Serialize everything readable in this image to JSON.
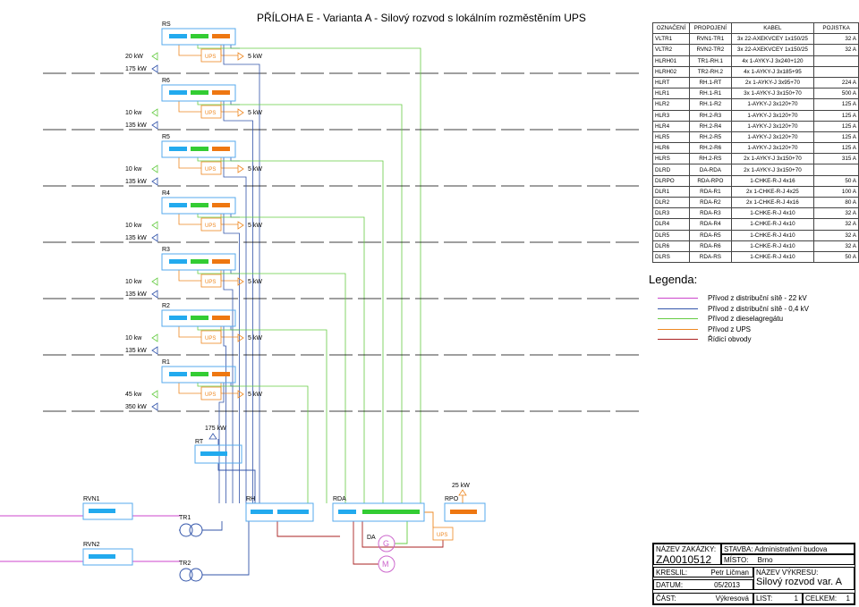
{
  "title": "PŘÍLOHA E - Varianta A - Silový rozvod s lokálním rozměstěním UPS",
  "cabinets": [
    {
      "name": "RS",
      "power_top": "20 kW",
      "power_bottom": "175 kW",
      "ups": "UPS",
      "ups_power": "5 kW"
    },
    {
      "name": "R6",
      "power_top": "10 kw",
      "power_bottom": "135 kW",
      "ups": "UPS",
      "ups_power": "5 kW"
    },
    {
      "name": "R5",
      "power_top": "10 kw",
      "power_bottom": "135 kW",
      "ups": "UPS",
      "ups_power": "5 kW"
    },
    {
      "name": "R4",
      "power_top": "10 kw",
      "power_bottom": "135 kW",
      "ups": "UPS",
      "ups_power": "5 kW"
    },
    {
      "name": "R3",
      "power_top": "10 kw",
      "power_bottom": "135 kW",
      "ups": "UPS",
      "ups_power": "5 kW"
    },
    {
      "name": "R2",
      "power_top": "10 kw",
      "power_bottom": "135 kW",
      "ups": "UPS",
      "ups_power": "5 kW"
    },
    {
      "name": "R1",
      "power_top": "45 kw",
      "power_bottom": "350 kW",
      "ups": "UPS",
      "ups_power": "5 kW"
    }
  ],
  "rt": {
    "name": "RT",
    "power": "175 kW"
  },
  "rpo": {
    "name": "RPO",
    "power": "25 kW",
    "ups": "UPS"
  },
  "bottom_labels": {
    "rvn1": "RVN1",
    "rvn2": "RVN2",
    "tr1": "TR1",
    "tr2": "TR2",
    "rh": "RH",
    "rda": "RDA",
    "da": "DA",
    "g": "G",
    "m": "M"
  },
  "cable_table": {
    "headers": [
      "OZNAČENÍ",
      "PROPOJENÍ",
      "KABEL",
      "POJISTKA"
    ],
    "rows": [
      [
        "VLTR1",
        "RVN1-TR1",
        "3x 22-AXEKVCEY 1x150/25",
        "32 A"
      ],
      [
        "VLTR2",
        "RVN2-TR2",
        "3x 22-AXEKVCEY 1x150/25",
        "32 A"
      ],
      [
        "HLRH01",
        "TR1-RH.1",
        "4x 1-AYKY-J 3x240+120",
        ""
      ],
      [
        "HLRH02",
        "TR2-RH.2",
        "4x 1-AYKY-J 3x185+95",
        ""
      ],
      [
        "HLRT",
        "RH.1-RT",
        "2x 1-AYKY-J 3x95+70",
        "224 A"
      ],
      [
        "HLR1",
        "RH.1-R1",
        "3x 1-AYKY-J 3x150+70",
        "500 A"
      ],
      [
        "HLR2",
        "RH.1-R2",
        "1-AYKY-J 3x120+70",
        "125 A"
      ],
      [
        "HLR3",
        "RH.2-R3",
        "1-AYKY-J 3x120+70",
        "125 A"
      ],
      [
        "HLR4",
        "RH.2-R4",
        "1-AYKY-J 3x120+70",
        "125 A"
      ],
      [
        "HLR5",
        "RH.2-R5",
        "1-AYKY-J 3x120+70",
        "125 A"
      ],
      [
        "HLR6",
        "RH.2-R6",
        "1-AYKY-J 3x120+70",
        "125 A"
      ],
      [
        "HLRS",
        "RH.2-RS",
        "2x 1-AYKY-J 3x150+70",
        "315 A"
      ],
      [
        "DLRD",
        "DA-RDA",
        "2x 1-AYKY-J 3x150+70",
        ""
      ],
      [
        "DLRPO",
        "RDA-RPO",
        "1-CHKE-R-J 4x16",
        "50 A"
      ],
      [
        "DLR1",
        "RDA-R1",
        "2x 1-CHKE-R-J 4x25",
        "100 A"
      ],
      [
        "DLR2",
        "RDA-R2",
        "2x 1-CHKE-R-J 4x16",
        "80 A"
      ],
      [
        "DLR3",
        "RDA-R3",
        "1-CHKE-R-J 4x10",
        "32 A"
      ],
      [
        "DLR4",
        "RDA-R4",
        "1-CHKE-R-J 4x10",
        "32 A"
      ],
      [
        "DLR5",
        "RDA-R5",
        "1-CHKE-R-J 4x10",
        "32 A"
      ],
      [
        "DLR6",
        "RDA-R6",
        "1-CHKE-R-J 4x10",
        "32 A"
      ],
      [
        "DLRS",
        "RDA-RS",
        "1-CHKE-R-J 4x10",
        "50 A"
      ]
    ]
  },
  "legend": {
    "title": "Legenda:",
    "items": [
      {
        "label": "Přívod z distribuční sítě - 22 kV",
        "color": "#cc44cc"
      },
      {
        "label": "Přívod z distribuční sítě - 0,4 kV",
        "color": "#3355aa"
      },
      {
        "label": "Přívod z dieselagregátu",
        "color": "#66cc44"
      },
      {
        "label": "Přívod z UPS",
        "color": "#ee8822"
      },
      {
        "label": "Řídicí obvody",
        "color": "#aa2222"
      }
    ]
  },
  "title_block": {
    "zakazka_label": "NÁZEV ZAKÁZKY:",
    "zakazka": "ZA0010512",
    "stavba_label": "STAVBA:",
    "stavba": "Administrativní budova",
    "misto_label": "MÍSTO:",
    "misto": "Brno",
    "kreslil_label": "KRESLIL:",
    "kreslil": "Petr Ličman",
    "vykres_label": "NÁZEV VÝKRESU:",
    "vykres": "Silový rozvod var. A",
    "datum_label": "DATUM:",
    "datum": "05/2013",
    "cast_label": "ČÁST:",
    "cast": "Výkresová",
    "list_label": "LIST:",
    "list": "1",
    "celkem_label": "CELKEM:",
    "celkem": "1"
  },
  "colors": {
    "hv": "#cc44cc",
    "lv": "#3355aa",
    "diesel": "#66cc44",
    "ups": "#ee8822",
    "ctrl": "#aa2222",
    "cab_blue": "#22aaee",
    "cab_green": "#33cc33",
    "cab_orange": "#ee7711",
    "box": "#55aaee"
  }
}
